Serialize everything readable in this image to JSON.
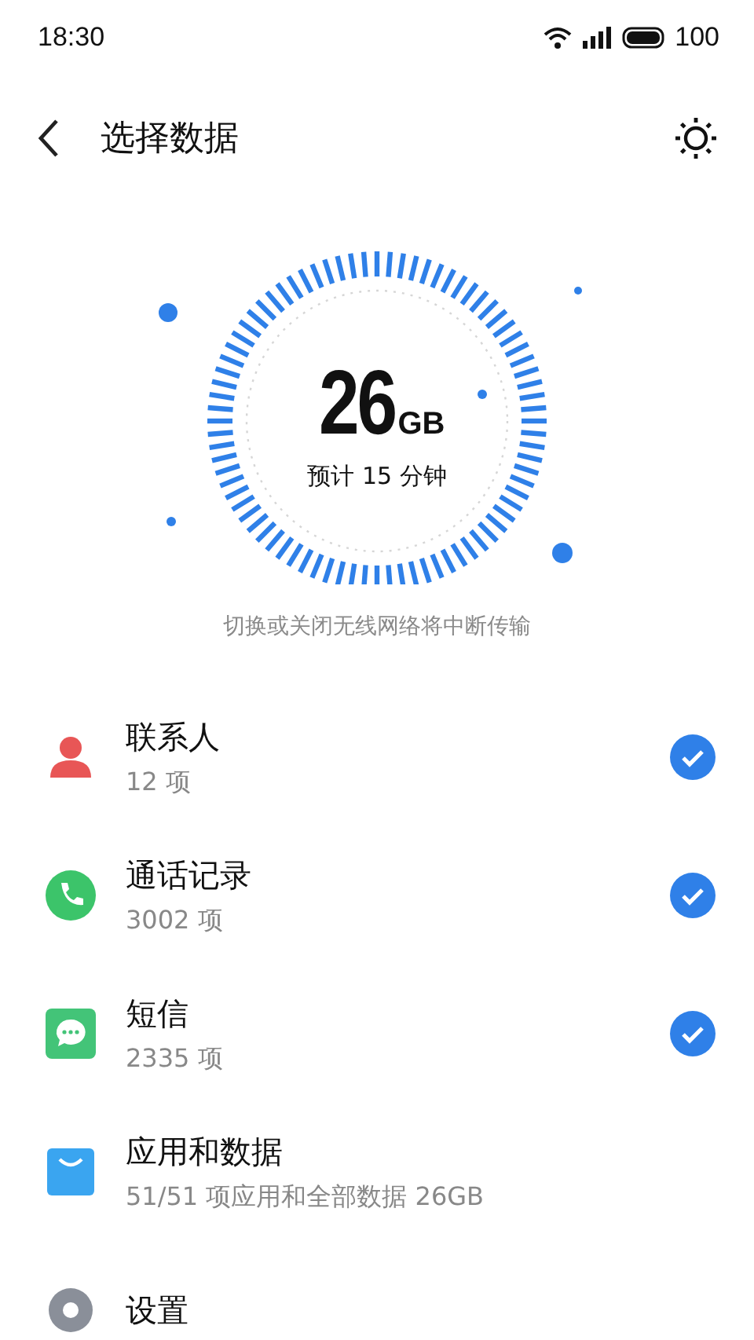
{
  "status_bar": {
    "time": "18:30",
    "battery": "100"
  },
  "header": {
    "title": "选择数据"
  },
  "summary": {
    "amount": "26",
    "unit": "GB",
    "estimate": "预计 15 分钟"
  },
  "notice": "切换或关闭无线网络将中断传输",
  "items": [
    {
      "kind": "contacts",
      "name": "联系人",
      "count": "12 项",
      "checked": true
    },
    {
      "kind": "calls",
      "name": "通话记录",
      "count": "3002 项",
      "checked": true
    },
    {
      "kind": "messages",
      "name": "短信",
      "count": "2335 项",
      "checked": true
    },
    {
      "kind": "apps",
      "name": "应用和数据",
      "count": "51/51 项应用和全部数据 26GB"
    },
    {
      "kind": "settings",
      "name": "设置"
    }
  ]
}
